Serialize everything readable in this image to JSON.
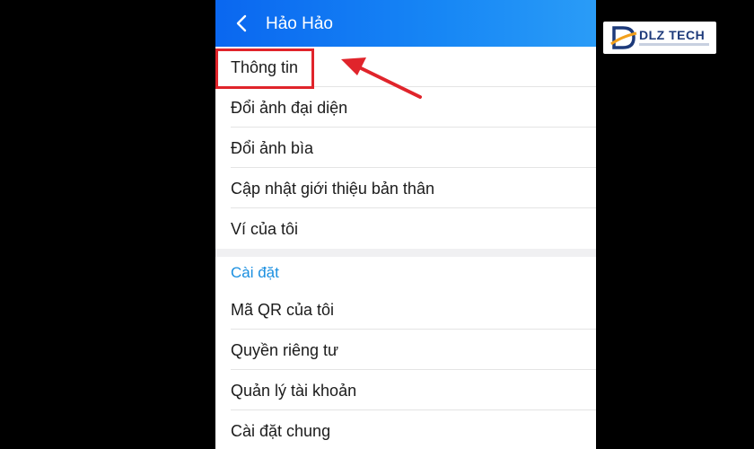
{
  "header": {
    "title": "Hảo Hảo",
    "back_icon": "chevron-left-icon",
    "background": "#1787f5"
  },
  "menu": {
    "items": [
      {
        "label": "Thông tin"
      },
      {
        "label": "Đổi ảnh đại diện"
      },
      {
        "label": "Đổi ảnh bìa"
      },
      {
        "label": "Cập nhật giới thiệu bản thân"
      },
      {
        "label": "Ví của tôi"
      }
    ]
  },
  "settings": {
    "section_title": "Cài đặt",
    "section_color": "#1a8fe0",
    "items": [
      {
        "label": "Mã QR của tôi"
      },
      {
        "label": "Quyền riêng tư"
      },
      {
        "label": "Quản lý tài khoản"
      },
      {
        "label": "Cài đặt chung"
      }
    ]
  },
  "annotation": {
    "highlight_color": "#e0242b",
    "arrow_icon": "red-arrow-pointer"
  },
  "watermark": {
    "brand": "DLZ TECH",
    "logo_icon": "dlz-tech-logo"
  }
}
